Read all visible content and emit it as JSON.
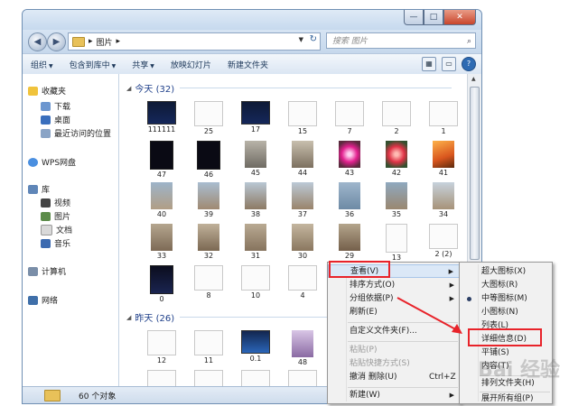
{
  "window": {
    "address": "图片",
    "search_placeholder": "搜索 图片",
    "controls": {
      "min": "—",
      "max": "□",
      "close": "✕"
    }
  },
  "toolbar": {
    "organize": "组织",
    "include": "包含到库中",
    "share": "共享",
    "slideshow": "放映幻灯片",
    "newfolder": "新建文件夹"
  },
  "nav": {
    "favorites": "收藏夹",
    "downloads": "下载",
    "desktop": "桌面",
    "recent": "最近访问的位置",
    "wps": "WPS网盘",
    "library": "库",
    "videos": "视频",
    "pictures": "图片",
    "documents": "文档",
    "music": "音乐",
    "computer": "计算机",
    "network": "网络"
  },
  "groups": {
    "today": "今天 (32)",
    "yesterday": "昨天 (26)"
  },
  "thumbs": {
    "r1": [
      "111111",
      "25",
      "17",
      "15",
      "7",
      "2",
      "1"
    ],
    "r2": [
      "47",
      "46",
      "45",
      "44",
      "43",
      "42",
      "41"
    ],
    "r3": [
      "40",
      "39",
      "38",
      "37",
      "36",
      "35",
      "34"
    ],
    "r4": [
      "33",
      "32",
      "31",
      "30",
      "29",
      "13",
      "2 (2)"
    ],
    "r5": [
      "0",
      "8",
      "10",
      "4"
    ],
    "r6": [
      "12",
      "11",
      "0.1",
      "48"
    ]
  },
  "status": {
    "count": "60 个对象"
  },
  "context_menu": {
    "view": "查看(V)",
    "sort": "排序方式(O)",
    "group": "分组依据(P)",
    "refresh": "刷新(E)",
    "customize": "自定义文件夹(F)...",
    "paste": "粘贴(P)",
    "paste_shortcut": "粘贴快捷方式(S)",
    "undo": "撤消 删除(U)",
    "undo_shortcut": "Ctrl+Z",
    "new": "新建(W)"
  },
  "view_submenu": {
    "xl": "超大图标(X)",
    "large": "大图标(R)",
    "medium": "中等图标(M)",
    "small": "小图标(N)",
    "list": "列表(L)",
    "details": "详细信息(D)",
    "tiles": "平铺(S)",
    "content": "内容(T)",
    "arrange": "排列文件夹(H)",
    "more": "展开所有组(P)"
  },
  "annotation": {
    "color": "#e8232a"
  },
  "watermark": "Bai 经验"
}
